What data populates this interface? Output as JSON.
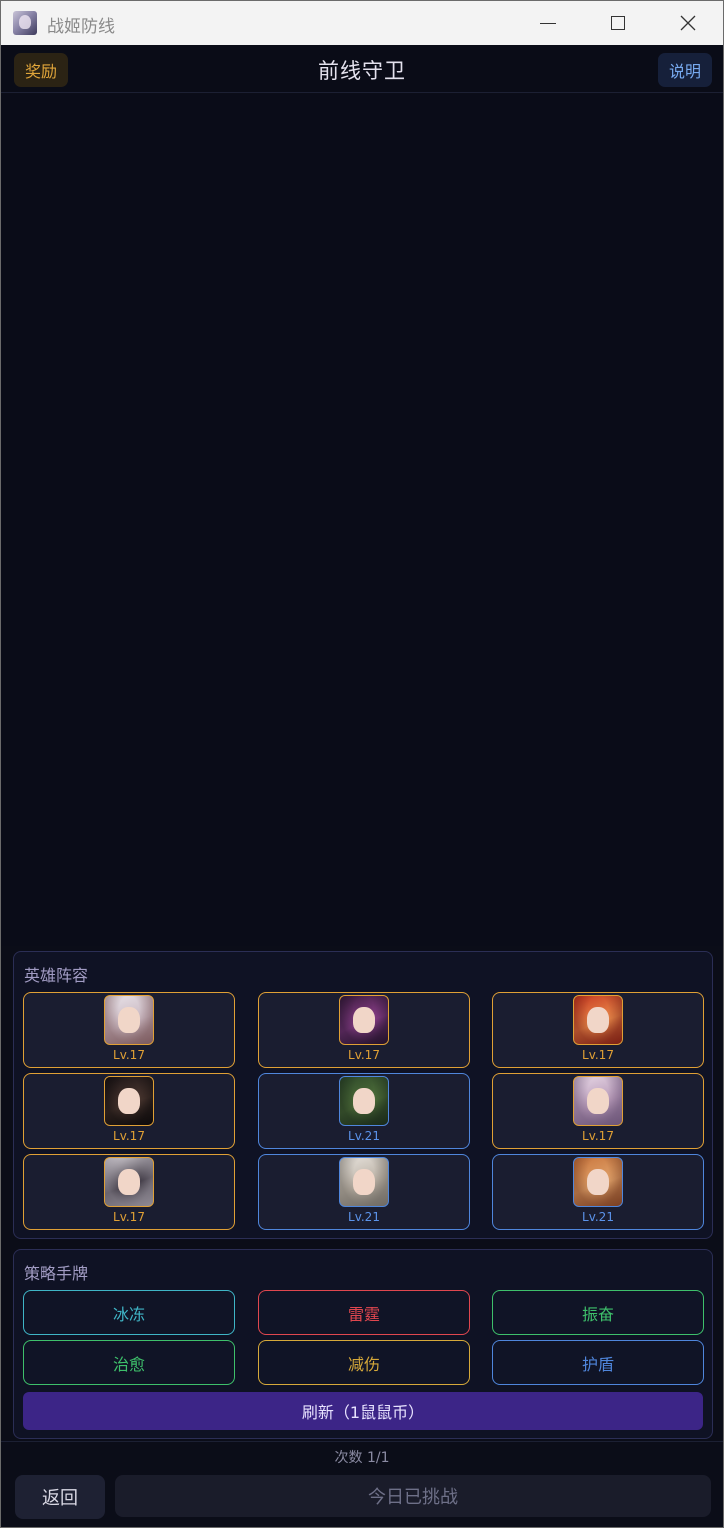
{
  "window": {
    "title": "战姬防线",
    "icon": "app-avatar-icon",
    "controls": [
      "minimize-icon",
      "maximize-icon",
      "close-icon"
    ]
  },
  "header": {
    "reward_label": "奖励",
    "title": "前线守卫",
    "help_label": "说明"
  },
  "heroes": {
    "label": "英雄阵容",
    "items": [
      {
        "level": "Lv.17",
        "frame": "gold",
        "palette": [
          "#e9e4ea",
          "#c9b7c0",
          "#7c5a5e"
        ]
      },
      {
        "level": "Lv.17",
        "frame": "gold",
        "palette": [
          "#3a1b3c",
          "#8d3f8c",
          "#22122a"
        ]
      },
      {
        "level": "Lv.17",
        "frame": "gold",
        "palette": [
          "#c63a22",
          "#e98a4a",
          "#7a1f14"
        ]
      },
      {
        "level": "Lv.17",
        "frame": "gold",
        "palette": [
          "#1b1416",
          "#4b3730",
          "#0d0a0b"
        ]
      },
      {
        "level": "Lv.21",
        "frame": "blue",
        "palette": [
          "#2f4a2a",
          "#4f6f3a",
          "#1a2a1a"
        ]
      },
      {
        "level": "Lv.17",
        "frame": "gold",
        "palette": [
          "#e8d8e6",
          "#b79ab8",
          "#6c5578"
        ]
      },
      {
        "level": "Lv.17",
        "frame": "gold",
        "palette": [
          "#d7d2d8",
          "#3b3540",
          "#8f8a94"
        ]
      },
      {
        "level": "Lv.21",
        "frame": "blue",
        "palette": [
          "#e7e2dc",
          "#b9b0a4",
          "#6f6a63"
        ]
      },
      {
        "level": "Lv.21",
        "frame": "blue",
        "palette": [
          "#c9763e",
          "#e0a26a",
          "#7a3f22"
        ]
      }
    ]
  },
  "cards": {
    "label": "策略手牌",
    "items": [
      {
        "label": "冰冻",
        "color": "#3fb5c6"
      },
      {
        "label": "雷霆",
        "color": "#e0474f"
      },
      {
        "label": "振奋",
        "color": "#3ec06b"
      },
      {
        "label": "治愈",
        "color": "#3ec06b"
      },
      {
        "label": "减伤",
        "color": "#d6a93a"
      },
      {
        "label": "护盾",
        "color": "#4f86dc"
      }
    ],
    "refresh_label": "刷新（1鼠鼠币）"
  },
  "footer": {
    "count_text": "次数 1/1",
    "back_label": "返回",
    "challenge_label": "今日已挑战"
  }
}
